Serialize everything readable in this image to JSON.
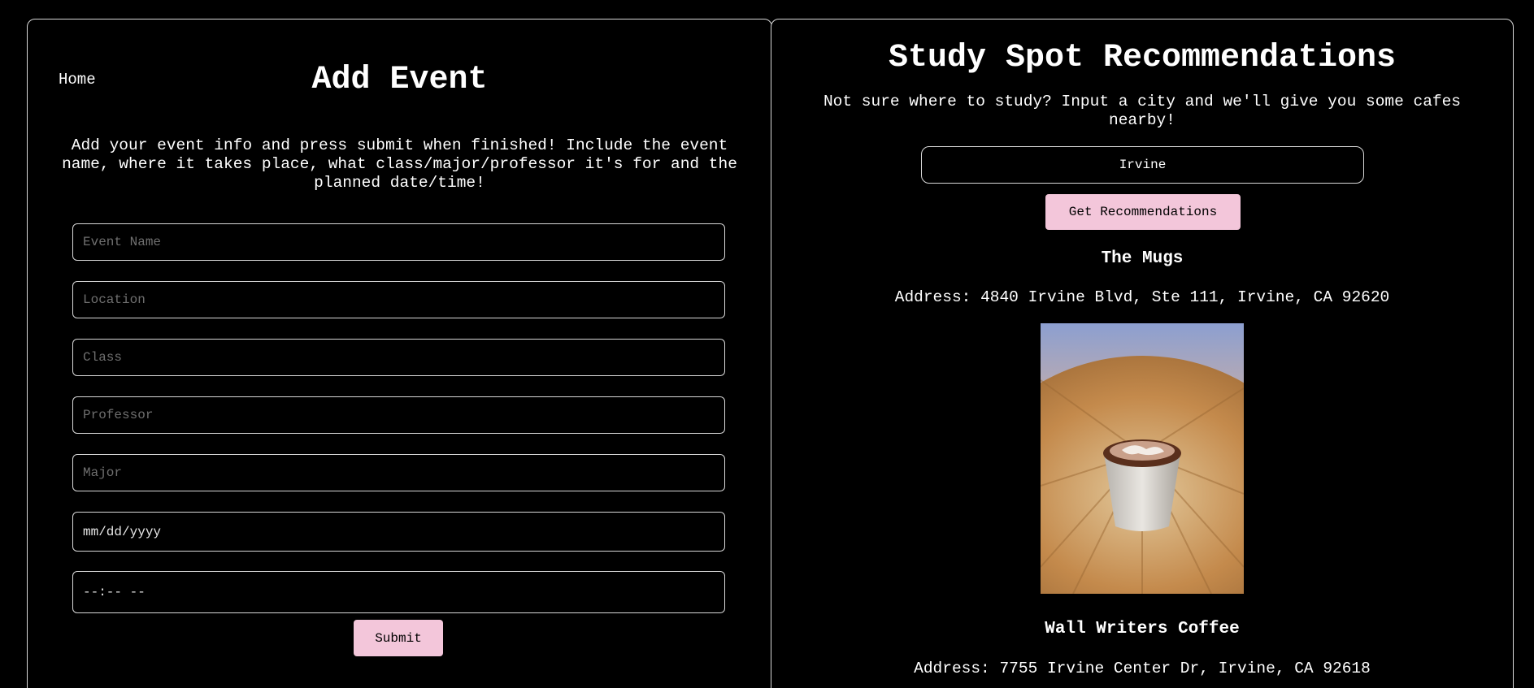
{
  "nav": {
    "home_label": "Home"
  },
  "add_event": {
    "title": "Add Event",
    "description": "Add your event info and press submit when finished! Include the event name, where it takes place, what class/major/professor it's for and the planned date/time!",
    "fields": {
      "event_name_placeholder": "Event Name",
      "location_placeholder": "Location",
      "class_placeholder": "Class",
      "professor_placeholder": "Professor",
      "major_placeholder": "Major",
      "date_placeholder": "mm/dd/yyyy",
      "time_placeholder": "--:-- --"
    },
    "submit_label": "Submit"
  },
  "study_spots": {
    "title": "Study Spot Recommendations",
    "description": "Not sure where to study? Input a city and we'll give you some cafes nearby!",
    "city_value": "Irvine",
    "button_label": "Get Recommendations",
    "cafes": [
      {
        "name": "The Mugs",
        "address": "Address: 4840 Irvine Blvd, Ste 111, Irvine, CA 92620"
      },
      {
        "name": "Wall Writers Coffee",
        "address": "Address: 7755 Irvine Center Dr, Irvine, CA 92618"
      }
    ]
  },
  "colors": {
    "background": "#000000",
    "accent_pink": "#f3c6da",
    "border": "#d9d9d9",
    "placeholder": "#6f6f6f"
  }
}
